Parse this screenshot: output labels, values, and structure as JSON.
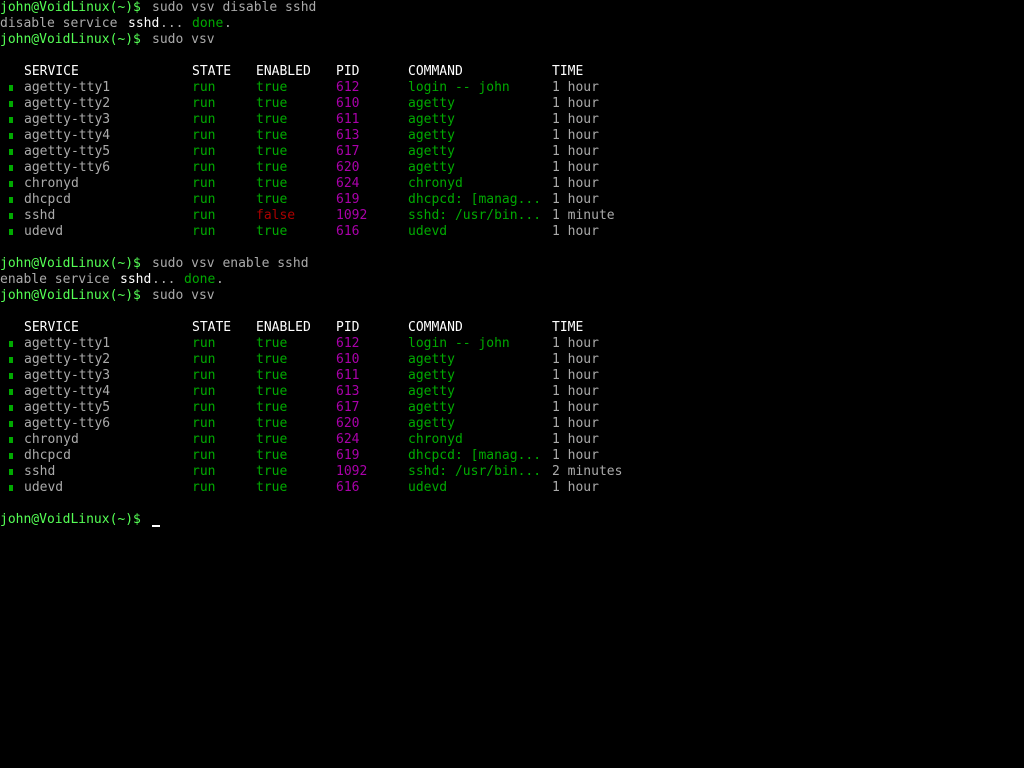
{
  "prompt": "john@VoidLinux(~)$",
  "colors": {
    "background": "#000000",
    "prompt": "#55ff55",
    "text": "#aaaaaa",
    "highlight": "#ffffff",
    "ok": "#00aa00",
    "error": "#aa0000",
    "pid": "#aa00aa"
  },
  "commands": {
    "c1": "sudo vsv disable sshd",
    "c2": "sudo vsv",
    "c3": "sudo vsv enable sshd",
    "c4": "sudo vsv"
  },
  "messages": {
    "m1": {
      "pre": "disable service ",
      "svc": "sshd",
      "dots": "... ",
      "done": "done",
      "end": "."
    },
    "m2": {
      "pre": "enable service ",
      "svc": "sshd",
      "dots": "... ",
      "done": "done",
      "end": "."
    }
  },
  "table_headers": {
    "service": "SERVICE",
    "state": "STATE",
    "enabled": "ENABLED",
    "pid": "PID",
    "command": "COMMAND",
    "time": "TIME"
  },
  "table1": [
    {
      "service": "agetty-tty1",
      "state": "run",
      "enabled": "true",
      "pid": "612",
      "command": "login -- john",
      "time": "1 hour"
    },
    {
      "service": "agetty-tty2",
      "state": "run",
      "enabled": "true",
      "pid": "610",
      "command": "agetty",
      "time": "1 hour"
    },
    {
      "service": "agetty-tty3",
      "state": "run",
      "enabled": "true",
      "pid": "611",
      "command": "agetty",
      "time": "1 hour"
    },
    {
      "service": "agetty-tty4",
      "state": "run",
      "enabled": "true",
      "pid": "613",
      "command": "agetty",
      "time": "1 hour"
    },
    {
      "service": "agetty-tty5",
      "state": "run",
      "enabled": "true",
      "pid": "617",
      "command": "agetty",
      "time": "1 hour"
    },
    {
      "service": "agetty-tty6",
      "state": "run",
      "enabled": "true",
      "pid": "620",
      "command": "agetty",
      "time": "1 hour"
    },
    {
      "service": "chronyd",
      "state": "run",
      "enabled": "true",
      "pid": "624",
      "command": "chronyd",
      "time": "1 hour"
    },
    {
      "service": "dhcpcd",
      "state": "run",
      "enabled": "true",
      "pid": "619",
      "command": "dhcpcd: [manag...",
      "time": "1 hour"
    },
    {
      "service": "sshd",
      "state": "run",
      "enabled": "false",
      "pid": "1092",
      "command": "sshd: /usr/bin...",
      "time": "1 minute"
    },
    {
      "service": "udevd",
      "state": "run",
      "enabled": "true",
      "pid": "616",
      "command": "udevd",
      "time": "1 hour"
    }
  ],
  "table2": [
    {
      "service": "agetty-tty1",
      "state": "run",
      "enabled": "true",
      "pid": "612",
      "command": "login -- john",
      "time": "1 hour"
    },
    {
      "service": "agetty-tty2",
      "state": "run",
      "enabled": "true",
      "pid": "610",
      "command": "agetty",
      "time": "1 hour"
    },
    {
      "service": "agetty-tty3",
      "state": "run",
      "enabled": "true",
      "pid": "611",
      "command": "agetty",
      "time": "1 hour"
    },
    {
      "service": "agetty-tty4",
      "state": "run",
      "enabled": "true",
      "pid": "613",
      "command": "agetty",
      "time": "1 hour"
    },
    {
      "service": "agetty-tty5",
      "state": "run",
      "enabled": "true",
      "pid": "617",
      "command": "agetty",
      "time": "1 hour"
    },
    {
      "service": "agetty-tty6",
      "state": "run",
      "enabled": "true",
      "pid": "620",
      "command": "agetty",
      "time": "1 hour"
    },
    {
      "service": "chronyd",
      "state": "run",
      "enabled": "true",
      "pid": "624",
      "command": "chronyd",
      "time": "1 hour"
    },
    {
      "service": "dhcpcd",
      "state": "run",
      "enabled": "true",
      "pid": "619",
      "command": "dhcpcd: [manag...",
      "time": "1 hour"
    },
    {
      "service": "sshd",
      "state": "run",
      "enabled": "true",
      "pid": "1092",
      "command": "sshd: /usr/bin...",
      "time": "2 minutes"
    },
    {
      "service": "udevd",
      "state": "run",
      "enabled": "true",
      "pid": "616",
      "command": "udevd",
      "time": "1 hour"
    }
  ]
}
